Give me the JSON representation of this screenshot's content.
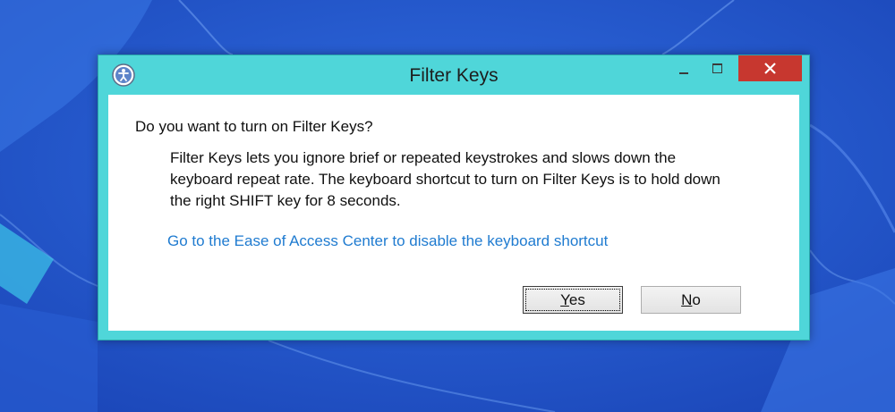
{
  "window": {
    "title": "Filter Keys",
    "icon": "ease-of-access-icon"
  },
  "dialog": {
    "question": "Do you want to turn on Filter Keys?",
    "description_lines": [
      "Filter Keys lets you ignore brief or repeated keystrokes and slows down the",
      "keyboard repeat rate.  The keyboard shortcut to turn on Filter Keys is to hold down",
      "the right SHIFT key for 8 seconds."
    ],
    "link_text": "Go to the Ease of Access Center to disable the keyboard shortcut"
  },
  "buttons": {
    "yes": {
      "accel": "Y",
      "rest": "es"
    },
    "no": {
      "accel": "N",
      "rest": "o"
    }
  },
  "colors": {
    "desktop": "#1f56c8",
    "window_frame": "#4fd6d9",
    "close_button": "#c7372f",
    "link": "#1f7bd0"
  }
}
